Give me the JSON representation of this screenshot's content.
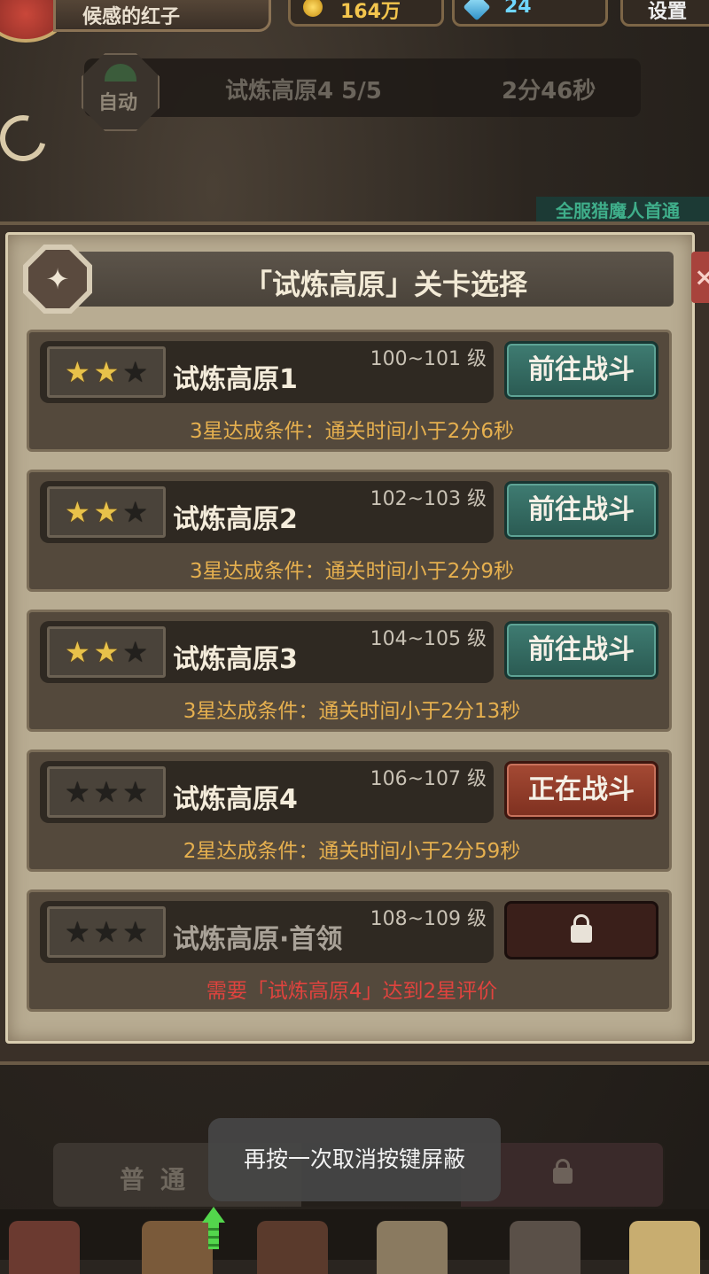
{
  "top_bar": {
    "player_name": "候感的红子",
    "gold": "164万",
    "gems": "24",
    "settings_label": "设置"
  },
  "auto": {
    "badge_label": "自动",
    "stage_progress": "试炼高原4  5/5",
    "timer": "2分46秒"
  },
  "banner_text": "全服猎魔人首通",
  "modal": {
    "title": "「试炼高原」关卡选择",
    "close_label": "×",
    "stages": [
      {
        "name": "试炼高原1",
        "level": "100~101 级",
        "stars": 2,
        "condition": "3星达成条件：通关时间小于2分6秒",
        "button": "前往战斗"
      },
      {
        "name": "试炼高原2",
        "level": "102~103 级",
        "stars": 2,
        "condition": "3星达成条件：通关时间小于2分9秒",
        "button": "前往战斗"
      },
      {
        "name": "试炼高原3",
        "level": "104~105 级",
        "stars": 2,
        "condition": "3星达成条件：通关时间小于2分13秒",
        "button": "前往战斗"
      },
      {
        "name": "试炼高原4",
        "level": "106~107 级",
        "stars": 0,
        "condition": "2星达成条件：通关时间小于2分59秒",
        "button": "正在战斗"
      },
      {
        "name": "试炼高原·首领",
        "level": "108~109 级",
        "stars": 0,
        "condition": "需要「试炼高原4」达到2星评价",
        "button": ""
      }
    ]
  },
  "bottom": {
    "tab_normal": "普通",
    "toast": "再按一次取消按键屏蔽"
  },
  "colors": {
    "go_button": "#2f6a60",
    "fighting_button": "#8f3a28",
    "condition_text": "#e6b04f",
    "locked_condition_text": "#e0433e",
    "star_on": "#e8c24a"
  }
}
